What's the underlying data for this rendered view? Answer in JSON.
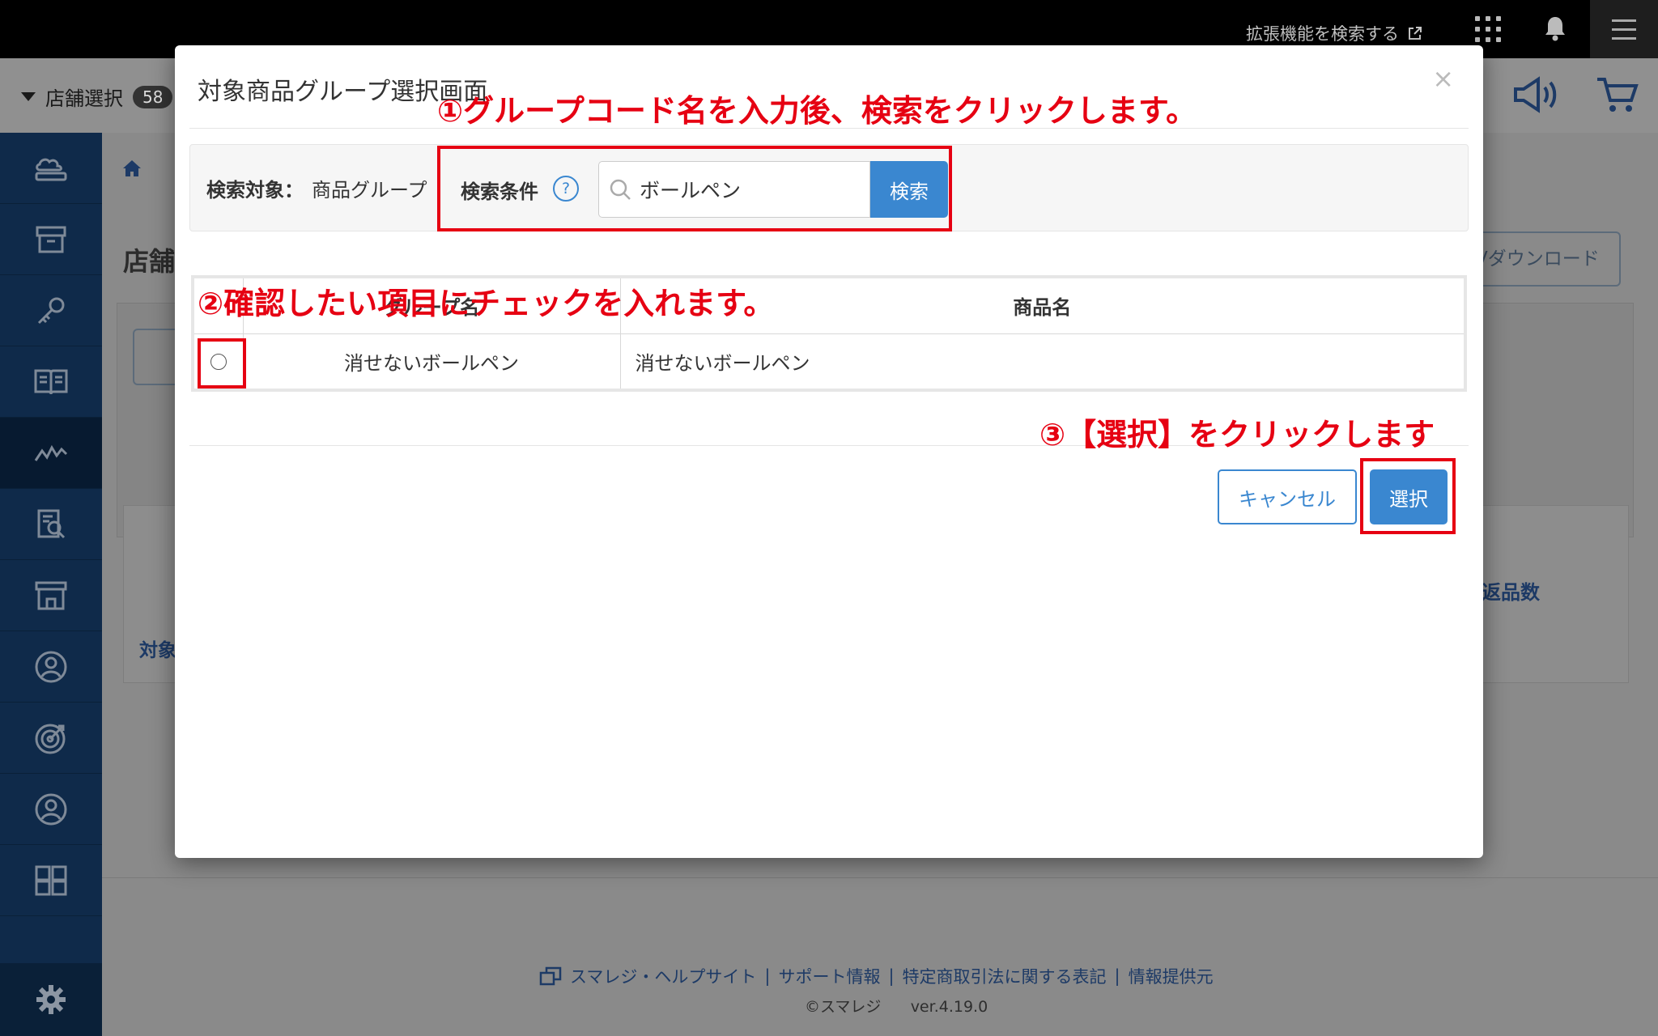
{
  "topbar": {
    "ext_link": "拡張機能を検索する"
  },
  "subbar": {
    "store_select": "店舗選択",
    "store_count": "58"
  },
  "background": {
    "heading_partial": "店舗",
    "csv_partial": "Vダウンロード",
    "col_partial": "返品数",
    "row_partial": "対象"
  },
  "modal": {
    "title": "対象商品グループ選択画面",
    "close": "×",
    "search": {
      "target_label": "検索対象：",
      "target_value": "商品グループ",
      "condition_label": "検索条件",
      "help": "?",
      "input_value": "ボールペン",
      "button": "検索"
    },
    "table": {
      "headers": [
        "",
        "グループ名",
        "商品名"
      ],
      "rows": [
        {
          "group": "消せないボールペン",
          "product": "消せないボールペン"
        }
      ]
    },
    "cancel_button": "キャンセル",
    "select_button": "選択"
  },
  "annotations": {
    "step1": "①グループコード名を入力後、検索をクリックします。",
    "step2": "②確認したい項目にチェックを入れます。",
    "step3": "③【選択】をクリックします"
  },
  "footer": {
    "links": [
      "スマレジ・ヘルプサイト",
      "サポート情報",
      "特定商取引法に関する表記",
      "情報提供元"
    ],
    "separator": "|",
    "copyright": "©スマレジ",
    "version": "ver.4.19.0"
  },
  "colors": {
    "accent": "#3a87d0",
    "annotation": "#e60012",
    "sidebar": "#0f2a4a"
  }
}
